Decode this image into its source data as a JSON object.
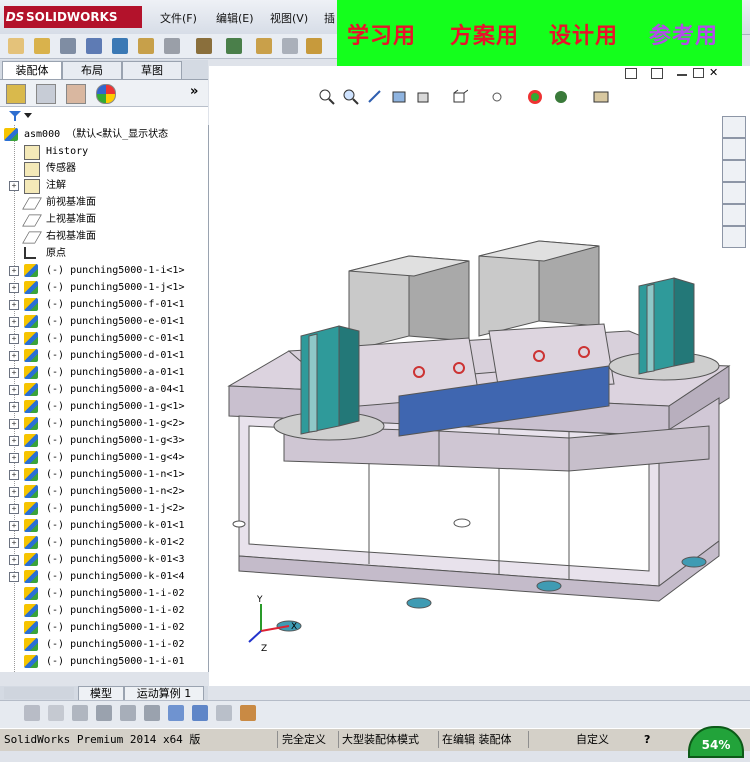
{
  "app": {
    "logo_ds": "DS",
    "logo_text": "SOLIDWORKS"
  },
  "menu": [
    "文件(F)",
    "编辑(E)",
    "视图(V)",
    "插"
  ],
  "banner": {
    "items": [
      {
        "text": "学习用",
        "color": "#e8132a"
      },
      {
        "text": "方案用",
        "color": "#e8132a"
      },
      {
        "text": "设计用",
        "color": "#e8132a"
      },
      {
        "text": "参考用",
        "color": "#b24ce8"
      }
    ]
  },
  "panel_tabs": [
    "装配体",
    "布局",
    "草图"
  ],
  "panel_expand": "»",
  "tree": {
    "root": "asm000 （默认<默认_显示状态",
    "fixed": [
      {
        "label": "History",
        "icon": "history-icon"
      },
      {
        "label": "传感器",
        "icon": "sensor-icon"
      },
      {
        "label": "注解",
        "icon": "annotation-icon",
        "expand": true
      },
      {
        "label": "前视基准面",
        "icon": "plane-icon"
      },
      {
        "label": "上视基准面",
        "icon": "plane-icon"
      },
      {
        "label": "右视基准面",
        "icon": "plane-icon"
      },
      {
        "label": "原点",
        "icon": "origin-icon"
      }
    ],
    "parts": [
      {
        "label": "(-) punching5000-1-i<1>",
        "expand": true
      },
      {
        "label": "(-) punching5000-1-j<1>",
        "expand": true
      },
      {
        "label": "(-) punching5000-f-01<1",
        "expand": true
      },
      {
        "label": "(-) punching5000-e-01<1",
        "expand": true
      },
      {
        "label": "(-) punching5000-c-01<1",
        "expand": true
      },
      {
        "label": "(-) punching5000-d-01<1",
        "expand": true
      },
      {
        "label": "(-) punching5000-a-01<1",
        "expand": true
      },
      {
        "label": "(-) punching5000-a-04<1",
        "expand": true
      },
      {
        "label": "(-) punching5000-1-g<1>",
        "expand": true
      },
      {
        "label": "(-) punching5000-1-g<2>",
        "expand": true
      },
      {
        "label": "(-) punching5000-1-g<3>",
        "expand": true
      },
      {
        "label": "(-) punching5000-1-g<4>",
        "expand": true
      },
      {
        "label": "(-) punching5000-1-n<1>",
        "expand": true
      },
      {
        "label": "(-) punching5000-1-n<2>",
        "expand": true
      },
      {
        "label": "(-) punching5000-1-j<2>",
        "expand": true
      },
      {
        "label": "(-) punching5000-k-01<1",
        "expand": true
      },
      {
        "label": "(-) punching5000-k-01<2",
        "expand": true
      },
      {
        "label": "(-) punching5000-k-01<3",
        "expand": true
      },
      {
        "label": "(-) punching5000-k-01<4",
        "expand": true
      },
      {
        "label": "(-) punching5000-1-i-02",
        "expand": false
      },
      {
        "label": "(-) punching5000-1-i-02",
        "expand": false
      },
      {
        "label": "(-) punching5000-1-i-02",
        "expand": false
      },
      {
        "label": "(-) punching5000-1-i-02",
        "expand": false
      },
      {
        "label": "(-) punching5000-1-i-01",
        "expand": false
      }
    ]
  },
  "bottom_tabs": [
    "模型",
    "运动算例 1"
  ],
  "status": {
    "version": "SolidWorks Premium 2014 x64 版",
    "defined": "完全定义",
    "mode": "大型装配体模式",
    "editing": "在编辑 装配体",
    "units": "自定义",
    "help": "?",
    "percent": "54%"
  }
}
